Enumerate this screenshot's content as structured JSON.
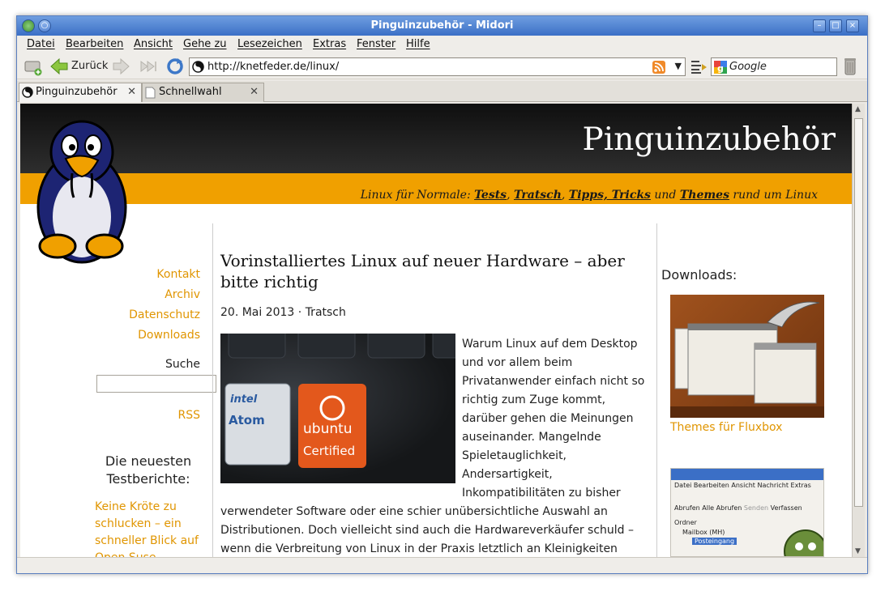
{
  "window": {
    "title": "Pinguinzubehör - Midori"
  },
  "menu": [
    "Datei",
    "Bearbeiten",
    "Ansicht",
    "Gehe zu",
    "Lesezeichen",
    "Extras",
    "Fenster",
    "Hilfe"
  ],
  "toolbar": {
    "back_label": "Zurück",
    "url": "http://knetfeder.de/linux/",
    "search_placeholder": "Google"
  },
  "tabs": [
    {
      "label": "Pinguinzubehör",
      "active": true
    },
    {
      "label": "Schnellwahl",
      "active": false
    }
  ],
  "site": {
    "title": "Pinguinzubehör",
    "tagline_prefix": "Linux für Normale: ",
    "tagline_links": [
      "Tests",
      "Tratsch",
      "Tipps, Tricks",
      "Themes"
    ],
    "tagline_sep1": ", ",
    "tagline_sep2": ", ",
    "tagline_and": " und ",
    "tagline_suffix": " rund um Linux"
  },
  "sidebar_left": {
    "links": [
      "Kontakt",
      "Archiv",
      "Datenschutz",
      "Downloads"
    ],
    "search_label": "Suche",
    "rss_label": "RSS",
    "newest_heading": "Die neuesten Testberichte:",
    "newest_item": "Keine Kröte zu schlucken – ein schneller Blick auf Open Suse"
  },
  "article": {
    "title": "Vorinstalliertes Linux auf neuer Hardware – aber bitte richtig",
    "meta": "20. Mai 2013 · Tratsch",
    "image_badge_intel": "intel",
    "image_badge_atom": "Atom",
    "image_badge_ubuntu": "ubuntu",
    "image_badge_certified": "Certified",
    "text_wrapped": "Warum Linux auf dem Desktop und vor allem beim Privatanwender einfach nicht so richtig zum Zuge kommt, darüber gehen die Meinungen auseinander. Mangelnde Spieletauglichkeit, Andersartigkeit, Inkompatibilitäten zu bisher",
    "text_full": "verwendeter Software oder eine schier unübersichtliche Auswahl an Distributionen. Doch vielleicht sind auch die Hardwareverkäufer schuld – wenn die Verbreitung von Linux in der Praxis letztlich an Kleinigkeiten"
  },
  "sidebar_right": {
    "downloads_heading": "Downloads:",
    "item1_caption": "Themes für Fluxbox",
    "thumb2_menu": [
      "Datei",
      "Bearbeiten",
      "Ansicht",
      "Nachricht",
      "Extras"
    ],
    "thumb2_buttons": [
      "Abrufen",
      "Alle Abrufen",
      "Senden",
      "Verfassen"
    ],
    "thumb2_folder_header": "Ordner",
    "thumb2_mailbox": "Mailbox (MH)",
    "thumb2_inbox": "Posteingang"
  }
}
